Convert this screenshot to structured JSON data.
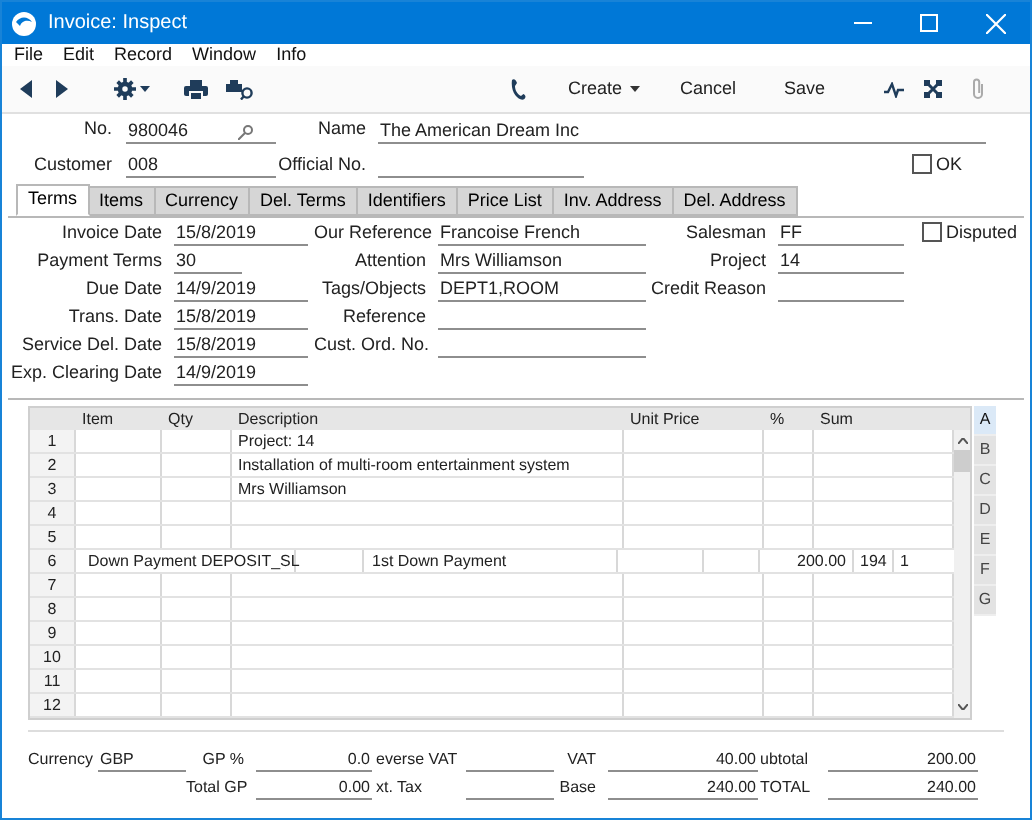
{
  "window": {
    "title": "Invoice: Inspect"
  },
  "menu": [
    "File",
    "Edit",
    "Record",
    "Window",
    "Info"
  ],
  "toolbar": [
    {
      "label": "Create",
      "menu": true
    },
    {
      "label": "Cancel",
      "menu": false
    },
    {
      "label": "Save",
      "menu": false
    }
  ],
  "header": {
    "no": {
      "label": "No.",
      "value": "980046"
    },
    "name": {
      "label": "Name",
      "value": "The American Dream Inc"
    },
    "customer": {
      "label": "Customer",
      "value": "008"
    },
    "official_no": {
      "label": "Official No."
    },
    "ok": {
      "label": "OK",
      "checked": false
    }
  },
  "tabs": [
    {
      "label": "Terms",
      "selected": true
    },
    {
      "label": "Items",
      "selected": false
    },
    {
      "label": "Currency",
      "selected": false
    },
    {
      "label": "Del. Terms",
      "selected": false
    },
    {
      "label": "Identifiers",
      "selected": false
    },
    {
      "label": "Price List",
      "selected": false
    },
    {
      "label": "Inv. Address",
      "selected": false
    },
    {
      "label": "Del. Address",
      "selected": false
    }
  ],
  "terms": {
    "column_1": [
      {
        "label": "Invoice Date",
        "value": "15/8/2019"
      },
      {
        "label": "Payment Terms",
        "value": "30"
      },
      {
        "label": "Due Date",
        "value": "14/9/2019"
      },
      {
        "label": "Trans. Date",
        "value": "15/8/2019"
      },
      {
        "label": "Service Del. Date",
        "value": "15/8/2019"
      },
      {
        "label": "Exp. Clearing Date",
        "value": "14/9/2019"
      }
    ],
    "column_2": [
      {
        "label": "Our Reference",
        "value": "Francoise French"
      },
      {
        "label": "Attention",
        "value": "Mrs Williamson"
      },
      {
        "label": "Tags/Objects",
        "value": "DEPT1,ROOM"
      },
      {
        "label": "Reference"
      },
      {
        "label": "Cust. Ord. No."
      }
    ],
    "column_3": [
      {
        "label": "Salesman",
        "value": "FF"
      },
      {
        "label": "Project",
        "value": "14"
      },
      {
        "label": "Credit Reason"
      }
    ],
    "disputed": {
      "label": "Disputed",
      "checked": false
    }
  },
  "grid": {
    "columns": [
      "Item",
      "Qty",
      "Description",
      "Unit Price",
      "%",
      "Sum"
    ],
    "rows": [
      {
        "kind": "normal",
        "number": "1",
        "description": "Project: 14"
      },
      {
        "kind": "normal",
        "number": "2",
        "description": "Installation of multi-room entertainment system"
      },
      {
        "kind": "normal",
        "number": "3",
        "description": "Mrs Williamson"
      },
      {
        "kind": "normal",
        "number": "4"
      },
      {
        "kind": "normal",
        "number": "5"
      },
      {
        "kind": "overflow",
        "number": "6",
        "item": "Down Payment",
        "code": "DEPOSIT_SL",
        "description": "1st Down Payment",
        "sum": "200.00",
        "column_7": "194",
        "column_8": "1"
      },
      {
        "kind": "normal",
        "number": "7"
      },
      {
        "kind": "normal",
        "number": "8"
      },
      {
        "kind": "normal",
        "number": "9"
      },
      {
        "kind": "normal",
        "number": "10"
      },
      {
        "kind": "normal",
        "number": "11"
      },
      {
        "kind": "normal",
        "number": "12"
      }
    ],
    "side_tabs": [
      {
        "label": "A",
        "selected": true
      },
      {
        "label": "B",
        "selected": false
      },
      {
        "label": "C",
        "selected": false
      },
      {
        "label": "D",
        "selected": false
      },
      {
        "label": "E",
        "selected": false
      },
      {
        "label": "F",
        "selected": false
      },
      {
        "label": "G",
        "selected": false
      }
    ]
  },
  "footer": {
    "currency": {
      "label": "Currency",
      "value": "GBP"
    },
    "gp_percent": {
      "label": "GP %",
      "value": "0.0"
    },
    "reverse_vat": {
      "label": "everse VAT"
    },
    "vat": {
      "label": "VAT",
      "value": "40.00"
    },
    "subtotal": {
      "label": "ubtotal",
      "value": "200.00"
    },
    "total_gp": {
      "label": "Total GP",
      "value": "0.00"
    },
    "ext_tax": {
      "label": "xt. Tax"
    },
    "base": {
      "label": "Base",
      "value": "240.00"
    },
    "total": {
      "label": "TOTAL",
      "value": "240.00"
    }
  }
}
